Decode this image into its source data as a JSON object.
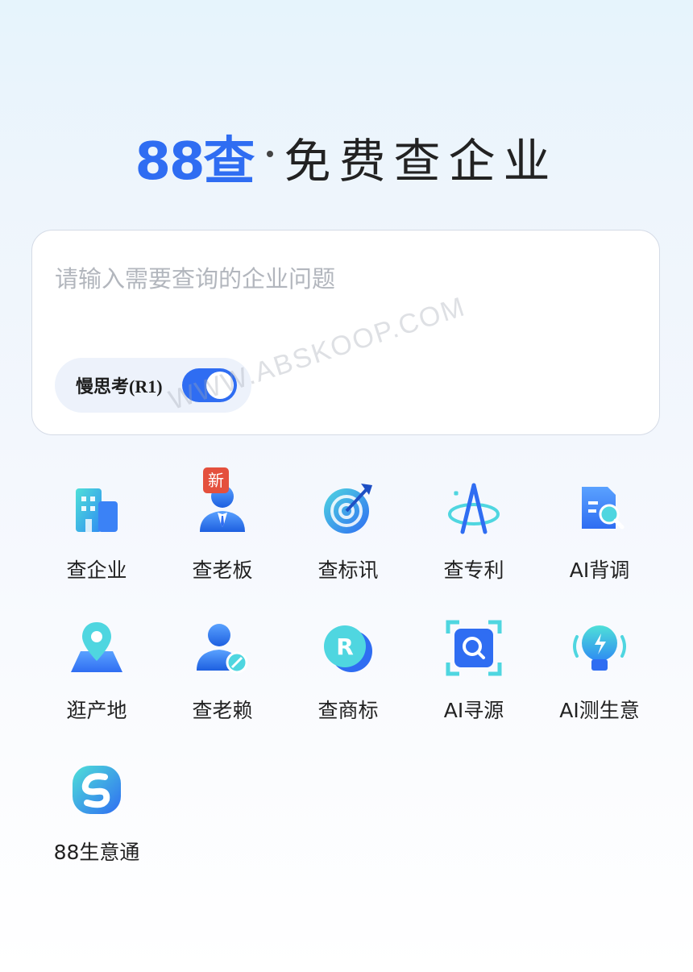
{
  "header": {
    "brand": "88查",
    "tagline": "免费查企业"
  },
  "search": {
    "placeholder": "请输入需要查询的企业问题",
    "mode_label": "慢思考(R1)",
    "mode_enabled": true
  },
  "watermark": "WWW.ABSKOOP.COM",
  "tools": [
    {
      "label": "查企业",
      "icon": "building-icon"
    },
    {
      "label": "查老板",
      "icon": "boss-icon",
      "badge": "新"
    },
    {
      "label": "查标讯",
      "icon": "target-icon"
    },
    {
      "label": "查专利",
      "icon": "patent-icon"
    },
    {
      "label": "AI背调",
      "icon": "document-search-icon"
    },
    {
      "label": "逛产地",
      "icon": "map-pin-icon"
    },
    {
      "label": "查老赖",
      "icon": "debtor-icon"
    },
    {
      "label": "查商标",
      "icon": "trademark-icon"
    },
    {
      "label": "AI寻源",
      "icon": "scan-search-icon"
    },
    {
      "label": "AI测生意",
      "icon": "lightbulb-icon"
    },
    {
      "label": "88生意通",
      "icon": "business-link-icon"
    }
  ],
  "colors": {
    "brand": "#2f6df2",
    "badge": "#e4503d"
  }
}
